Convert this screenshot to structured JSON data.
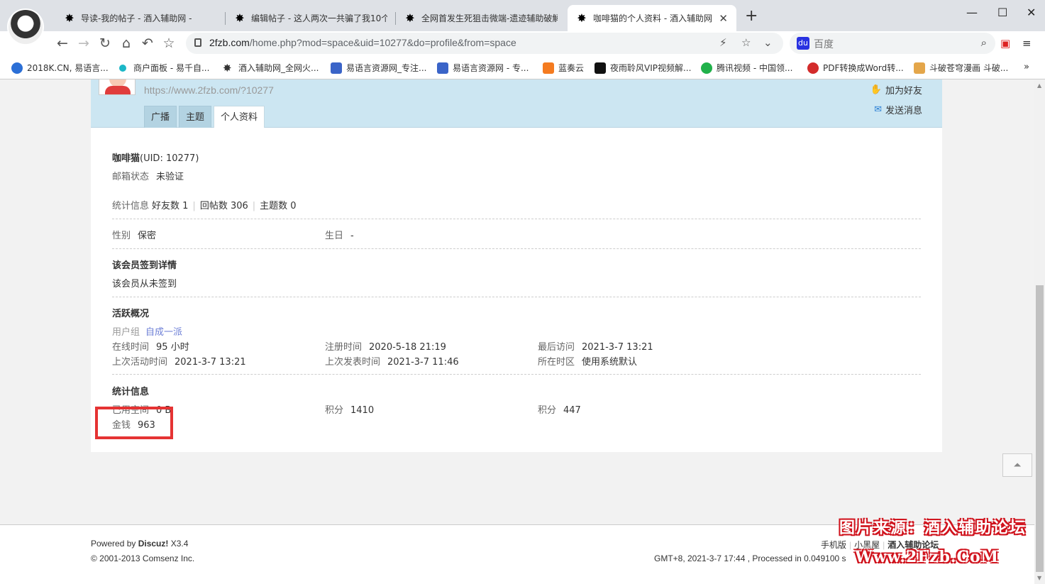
{
  "browser": {
    "tabs": [
      {
        "title": "导读-我的帖子 - 酒入辅助网 -",
        "active": false
      },
      {
        "title": "编辑帖子 - 这人两次一共骗了我10个",
        "active": false
      },
      {
        "title": "全网首发生死狙击微端-遗迹辅助破解",
        "active": false
      },
      {
        "title": "咖啡猫的个人资料 - 酒入辅助网",
        "active": true
      }
    ],
    "url_host": "2fzb.com",
    "url_path": "/home.php?mod=space&uid=10277&do=profile&from=space",
    "search_placeholder": "百度",
    "bookmarks": [
      {
        "label": "2018K.CN, 易语言...",
        "color": "#2b6fd6"
      },
      {
        "label": "商户面板 - 易千自...",
        "color": "#1cb7c7"
      },
      {
        "label": "酒入辅助网_全网火...",
        "color": "#111111"
      },
      {
        "label": "易语言资源网_专注...",
        "color": "#3a64c8"
      },
      {
        "label": "易语言资源网 - 专...",
        "color": "#3a64c8"
      },
      {
        "label": "蓝奏云",
        "color": "#f47b20"
      },
      {
        "label": "夜雨聆风VIP视频解...",
        "color": "#111111"
      },
      {
        "label": "腾讯视频 - 中国领...",
        "color": "#20b14a"
      },
      {
        "label": "PDF转换成Word转...",
        "color": "#d32b2b"
      },
      {
        "label": "斗破苍穹漫画 斗破...",
        "color": "#e4a64a"
      }
    ],
    "bookmarks_more": "»"
  },
  "profile": {
    "space_url": "https://www.2fzb.com/?10277",
    "tabs": [
      "广播",
      "主题",
      "个人资料"
    ],
    "actions": {
      "add_friend": "加为好友",
      "send_message": "发送消息"
    },
    "username": "咖啡猫",
    "uid": "(UID: 10277)",
    "email_label": "邮箱状态",
    "email_value": "未验证",
    "stats_line": {
      "label": "统计信息",
      "friends": "好友数 1",
      "replies": "回帖数 306",
      "threads": "主题数 0"
    },
    "gender_label": "性别",
    "gender_value": "保密",
    "birthday_label": "生日",
    "birthday_value": "-",
    "signin_title": "该会员签到详情",
    "signin_text": "该会员从未签到",
    "activity_title": "活跃概况",
    "usergroup_label": "用户组",
    "usergroup_value": "自成一派",
    "online_label": "在线时间",
    "online_value": "95 小时",
    "register_label": "注册时间",
    "register_value": "2020-5-18 21:19",
    "lastvisit_label": "最后访问",
    "lastvisit_value": "2021-3-7 13:21",
    "lastactive_label": "上次活动时间",
    "lastactive_value": "2021-3-7 13:21",
    "lastpost_label": "上次发表时间",
    "lastpost_value": "2021-3-7 11:46",
    "timezone_label": "所在时区",
    "timezone_value": "使用系统默认",
    "stats_title": "统计信息",
    "space_used_label": "已用空间",
    "space_used_value": "0 B",
    "credits1_label": "积分",
    "credits1_value": "1410",
    "credits2_label": "积分",
    "credits2_value": "447",
    "money_label": "金钱",
    "money_value": "963"
  },
  "footer": {
    "powered_prefix": "Powered by ",
    "powered_brand": "Discuz!",
    "powered_version": " X3.4",
    "copyright": "© 2001-2013 Comsenz Inc.",
    "links": [
      "手机版",
      "小黑屋",
      "酒入辅助论坛"
    ],
    "processed": "GMT+8, 2021-3-7 17:44 , Processed in 0.049100 s"
  },
  "watermark": {
    "line1": "图片来源：酒入辅助论坛",
    "line2": "Www.2Fzb.CoM"
  },
  "colors": {
    "accent_red": "#e53333",
    "header_blue": "#cce6f2",
    "link_blue": "#6d7fd6"
  }
}
